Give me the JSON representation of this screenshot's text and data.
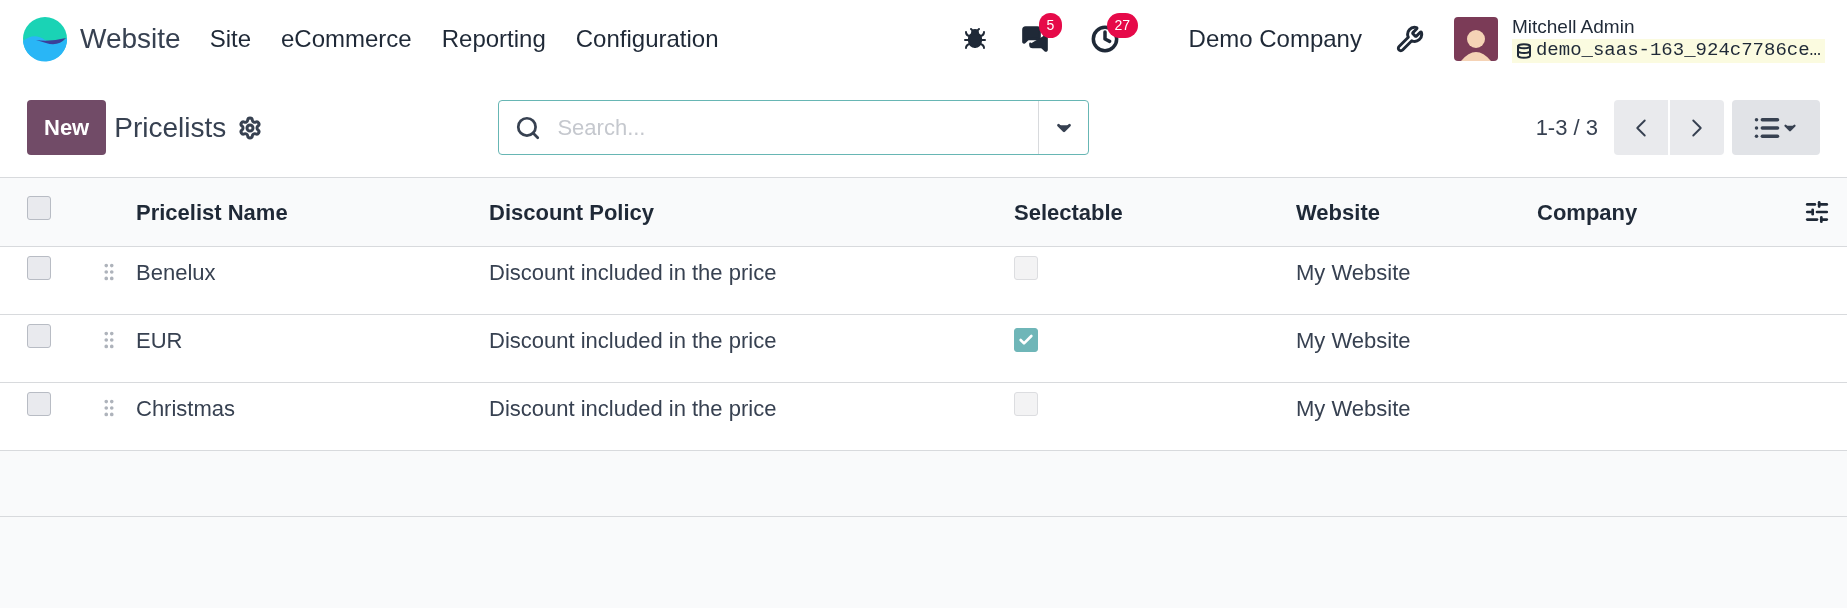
{
  "navbar": {
    "app_name": "Website",
    "menu": [
      "Site",
      "eCommerce",
      "Reporting",
      "Configuration"
    ],
    "messages_count": "5",
    "activities_count": "27",
    "company": "Demo Company",
    "user": {
      "name": "Mitchell Admin",
      "database": "demo_saas-163_924c7786ce…"
    }
  },
  "control_panel": {
    "new_button": "New",
    "title": "Pricelists",
    "search": {
      "placeholder": "Search..."
    },
    "pager": "1-3 / 3"
  },
  "table": {
    "all_selected": false,
    "columns": [
      "Pricelist Name",
      "Discount Policy",
      "Selectable",
      "Website",
      "Company"
    ],
    "rows": [
      {
        "selected": false,
        "name": "Benelux",
        "discount_policy": "Discount included in the price",
        "selectable": false,
        "website": "My Website"
      },
      {
        "selected": false,
        "name": "EUR",
        "discount_policy": "Discount included in the price",
        "selectable": true,
        "website": "My Website"
      },
      {
        "selected": false,
        "name": "Christmas",
        "discount_policy": "Discount included in the price",
        "selectable": false,
        "website": "My Website"
      }
    ]
  }
}
